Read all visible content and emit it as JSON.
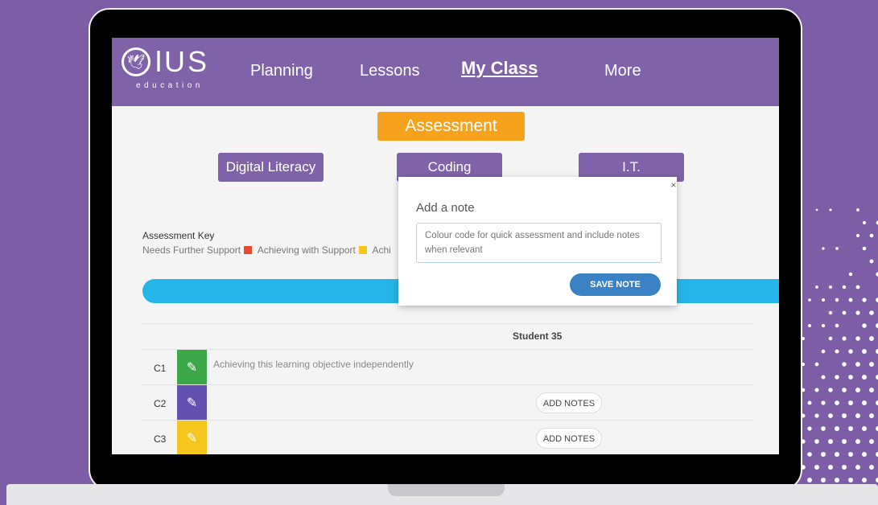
{
  "brand": {
    "logo_text": "lUS",
    "logo_sub": "education"
  },
  "nav": {
    "items": [
      {
        "label": "Planning"
      },
      {
        "label": "Lessons"
      },
      {
        "label": "My Class"
      },
      {
        "label": "More"
      }
    ],
    "active": "My Class"
  },
  "assessment_button": "Assessment",
  "subjects": [
    {
      "label": "Digital Literacy"
    },
    {
      "label": "Coding"
    },
    {
      "label": "I.T."
    }
  ],
  "assessment_key": {
    "title": "Assessment Key",
    "items": [
      {
        "label": "Needs Further Support",
        "color": "#e8482c"
      },
      {
        "label": "Achieving with Support",
        "color": "#f4c61e"
      },
      {
        "label": "Achi",
        "color": "#3ca84a"
      }
    ]
  },
  "table": {
    "student_header": "Student 35",
    "rows": [
      {
        "label": "C1",
        "color": "#3ca84a",
        "note": "Achieving this learning objective independently"
      },
      {
        "label": "C2",
        "color": "#6251b0",
        "action": "ADD NOTES"
      },
      {
        "label": "C3",
        "color": "#f4c61e",
        "action": "ADD NOTES"
      }
    ]
  },
  "modal": {
    "close": "×",
    "title": "Add a note",
    "note_value": "Colour code for quick assessment and include notes when relevant",
    "save_label": "SAVE NOTE"
  },
  "colors": {
    "brand_purple": "#7f62a8",
    "accent_orange": "#f7a21d",
    "progress_blue": "#26b5e8",
    "save_blue": "#3a82c4"
  }
}
